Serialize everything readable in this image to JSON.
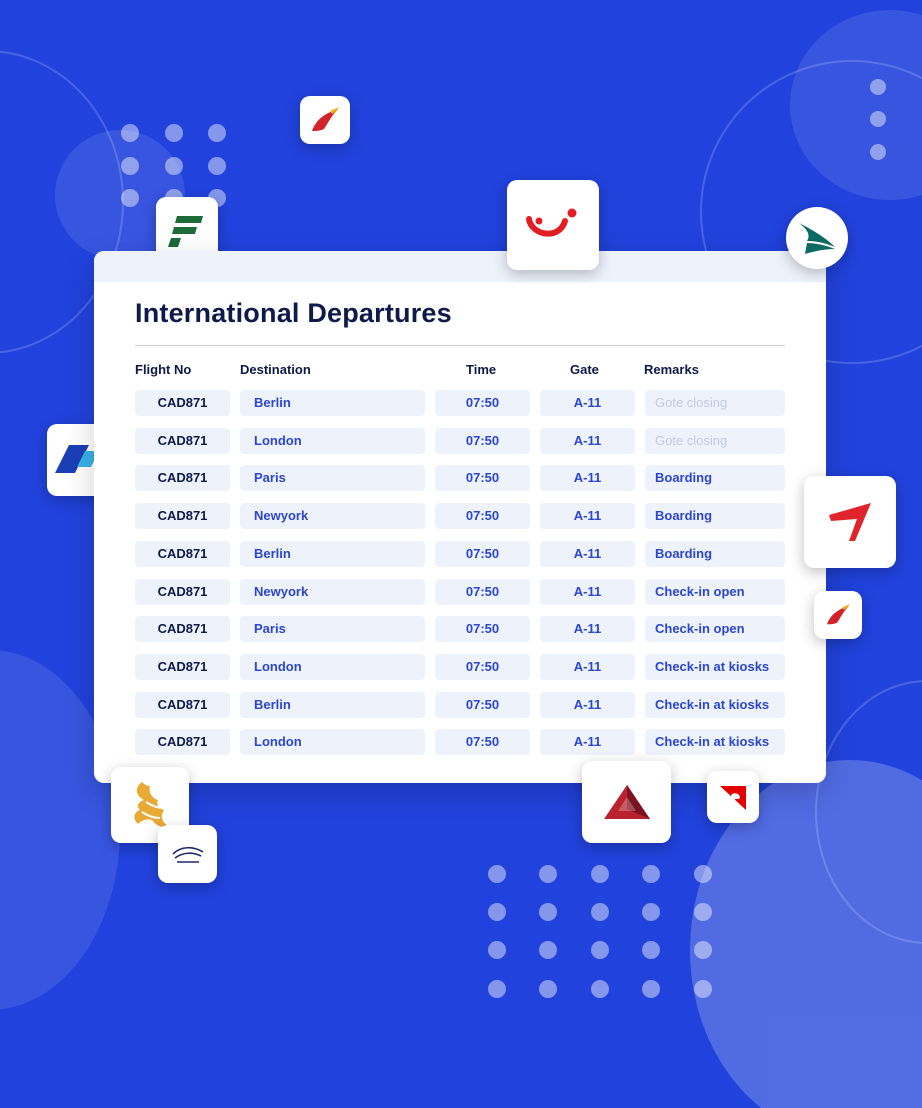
{
  "board": {
    "title": "International Departures",
    "columns": {
      "flight": "Flight No",
      "destination": "Destination",
      "time": "Time",
      "gate": "Gate",
      "remarks": "Remarks"
    },
    "rows": [
      {
        "flight": "CAD871",
        "destination": "Berlin",
        "time": "07:50",
        "gate": "A-11",
        "remarks": "Gote closing",
        "muted": true
      },
      {
        "flight": "CAD871",
        "destination": "London",
        "time": "07:50",
        "gate": "A-11",
        "remarks": "Gote closing",
        "muted": true
      },
      {
        "flight": "CAD871",
        "destination": "Paris",
        "time": "07:50",
        "gate": "A-11",
        "remarks": "Boarding",
        "muted": false
      },
      {
        "flight": "CAD871",
        "destination": "Newyork",
        "time": "07:50",
        "gate": "A-11",
        "remarks": "Boarding",
        "muted": false
      },
      {
        "flight": "CAD871",
        "destination": "Berlin",
        "time": "07:50",
        "gate": "A-11",
        "remarks": "Boarding",
        "muted": false
      },
      {
        "flight": "CAD871",
        "destination": "Newyork",
        "time": "07:50",
        "gate": "A-11",
        "remarks": "Check-in open",
        "muted": false
      },
      {
        "flight": "CAD871",
        "destination": "Paris",
        "time": "07:50",
        "gate": "A-11",
        "remarks": "Check-in open",
        "muted": false
      },
      {
        "flight": "CAD871",
        "destination": "London",
        "time": "07:50",
        "gate": "A-11",
        "remarks": "Check-in at kiosks",
        "muted": false
      },
      {
        "flight": "CAD871",
        "destination": "Berlin",
        "time": "07:50",
        "gate": "A-11",
        "remarks": "Check-in at kiosks",
        "muted": false
      },
      {
        "flight": "CAD871",
        "destination": "London",
        "time": "07:50",
        "gate": "A-11",
        "remarks": "Check-in at kiosks",
        "muted": false
      }
    ]
  },
  "logos": [
    "iberia-logo-icon",
    "frontier-logo-icon",
    "tui-logo-icon",
    "cathay-pacific-logo-icon",
    "blue-stripe-airline-logo-icon",
    "red-arrow-airline-logo-icon",
    "iberia-small-logo-icon",
    "singapore-airlines-logo-icon",
    "air-france-klm-logo-icon",
    "delta-logo-icon",
    "qantas-logo-icon"
  ],
  "colors": {
    "background": "#2142dc",
    "card": "#ffffff",
    "title": "#0d1a4a",
    "cell": "#eef2fb",
    "cell_text": "#2b46cf",
    "muted_text": "#c2c9e6"
  }
}
